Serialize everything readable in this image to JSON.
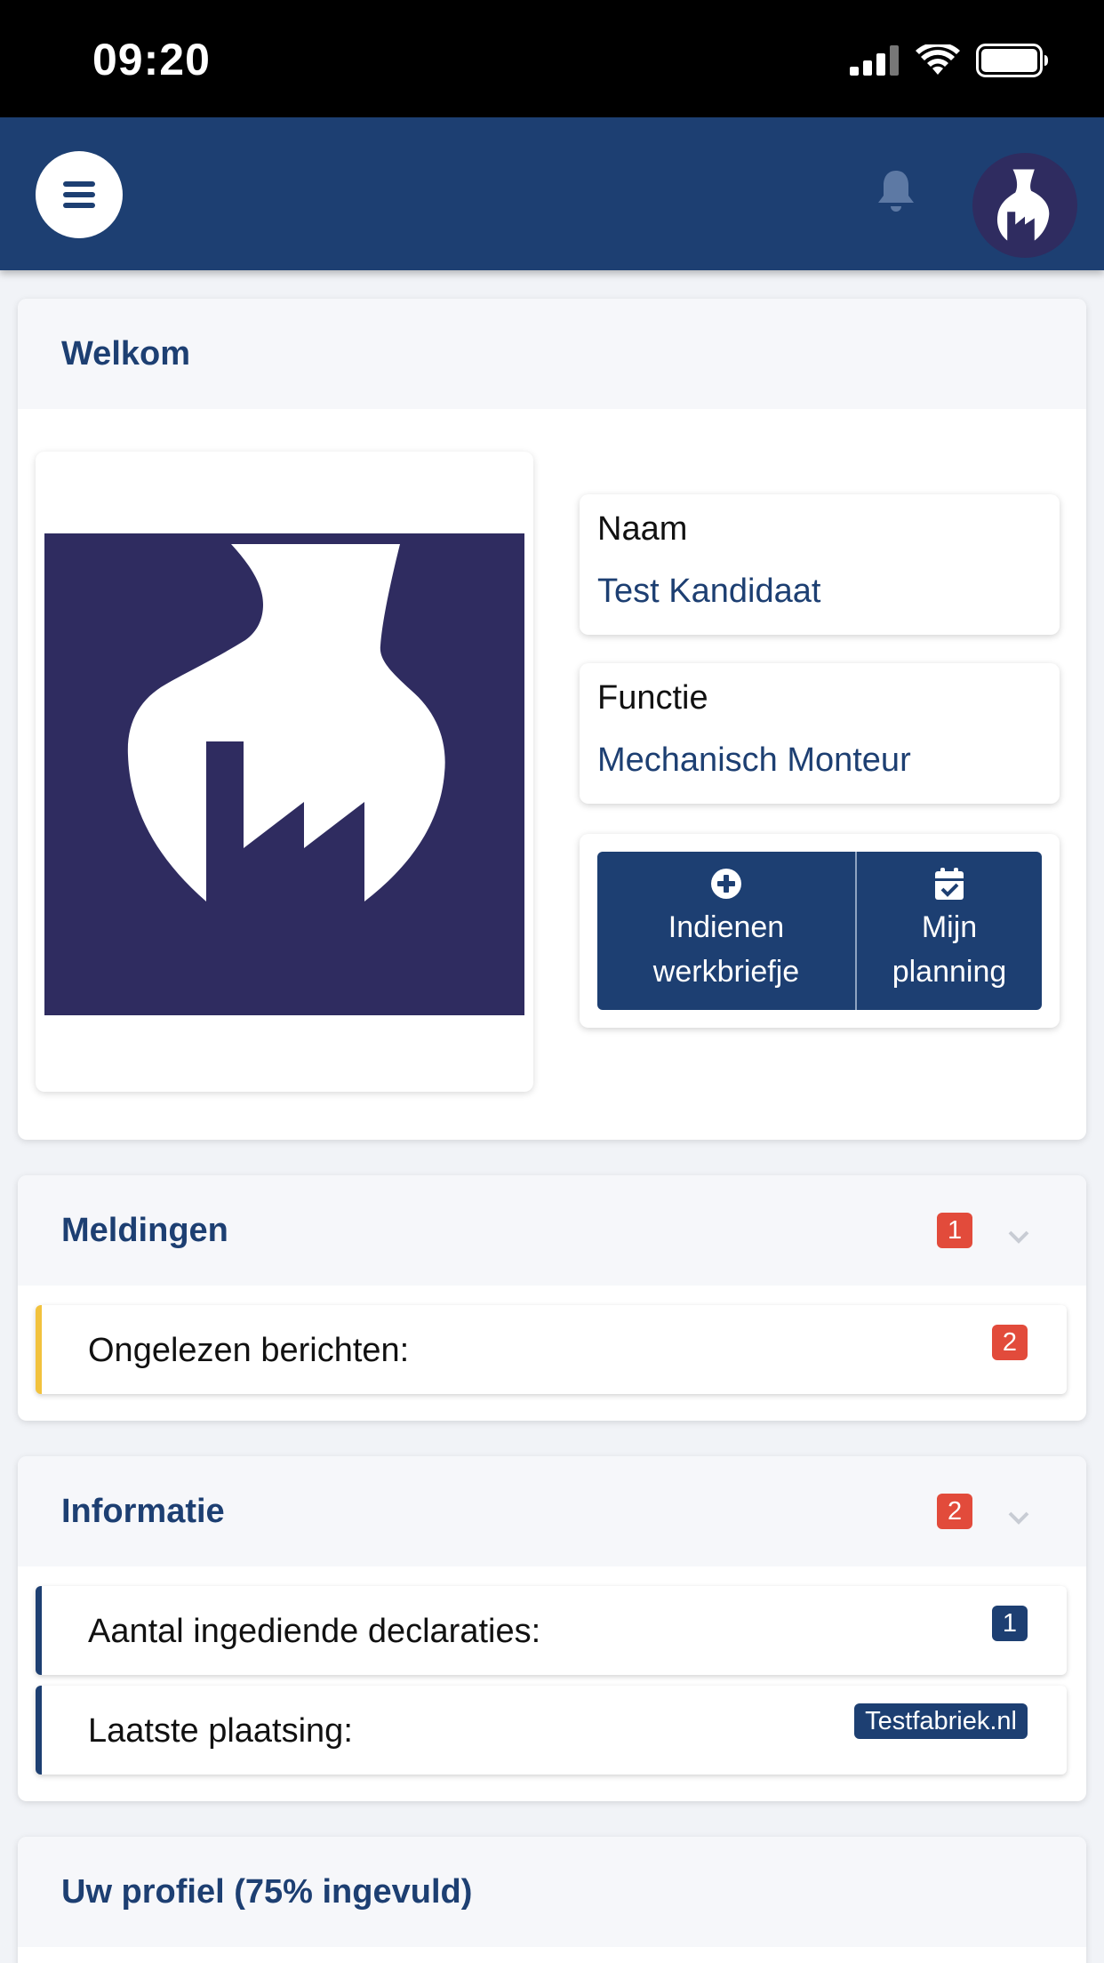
{
  "status_bar": {
    "time": "09:20"
  },
  "welcome": {
    "title": "Welkom",
    "name_label": "Naam",
    "name_value": "Test Kandidaat",
    "function_label": "Functie",
    "function_value": "Mechanisch Monteur",
    "submit_button": {
      "line1": "Indienen",
      "line2": "werkbriefje",
      "icon": "plus-circle-icon"
    },
    "planning_button": {
      "line1": "Mijn",
      "line2": "planning",
      "icon": "calendar-check-icon"
    }
  },
  "notifications": {
    "title": "Meldingen",
    "count": "1",
    "items": [
      {
        "label": "Ongelezen berichten:",
        "badge": "2"
      }
    ]
  },
  "information": {
    "title": "Informatie",
    "count": "2",
    "items": [
      {
        "label": "Aantal ingediende declaraties:",
        "badge": "1"
      },
      {
        "label": "Laatste plaatsing:",
        "badge": "Testfabriek.nl"
      }
    ]
  },
  "profile": {
    "title": "Uw profiel (75% ingevuld)"
  },
  "colors": {
    "primary": "#1d3f72",
    "logo_bg": "#2f2c60",
    "badge_red": "#e24b3b",
    "warning": "#f2c23d"
  }
}
